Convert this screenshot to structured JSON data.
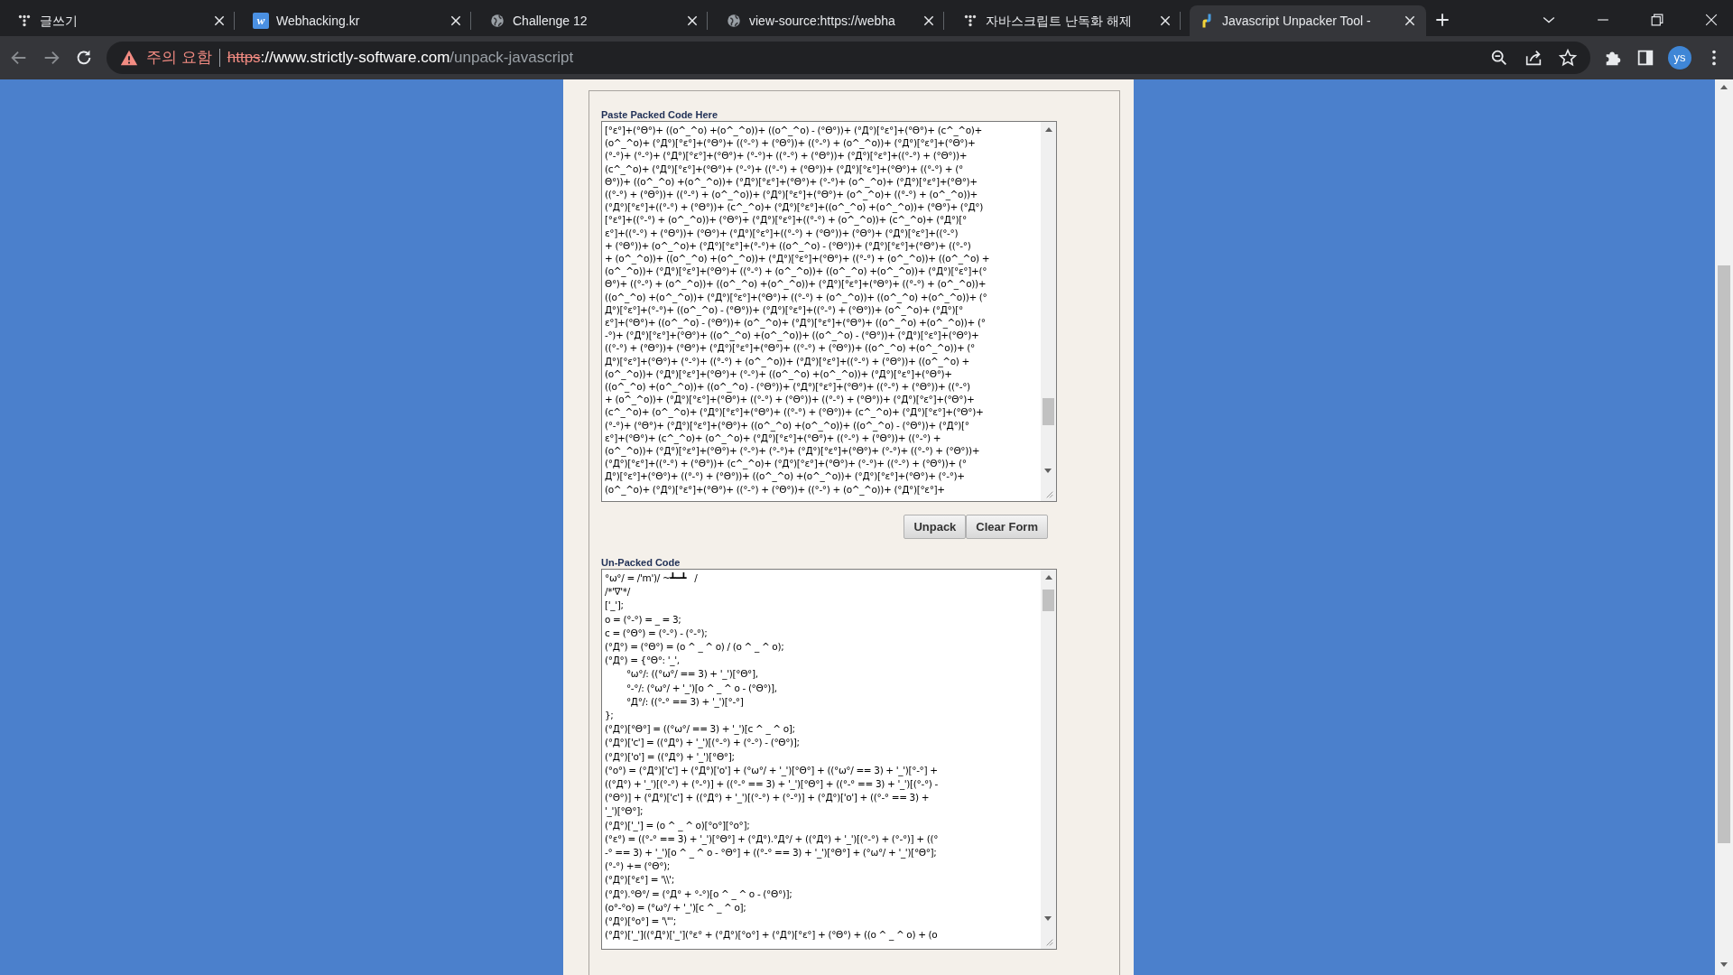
{
  "browser": {
    "tabs": [
      {
        "kind": "dots",
        "title": "글쓰기",
        "selected": false
      },
      {
        "kind": "letter",
        "icon_text": "w",
        "title": "Webhacking.kr",
        "selected": false
      },
      {
        "kind": "globe",
        "title": "Challenge 12",
        "selected": false
      },
      {
        "kind": "globe",
        "title": "view-source:https://webha",
        "selected": false
      },
      {
        "kind": "dots",
        "title": "자바스크립트 난독화 해제",
        "selected": false
      },
      {
        "kind": "js",
        "title": "Javascript Unpacker Tool -",
        "selected": true
      }
    ],
    "address": {
      "warning": "주의 요함",
      "scheme": "https",
      "host": "://www.strictly-software.com",
      "path": "/unpack-javascript"
    },
    "profile": "ys"
  },
  "page": {
    "packed": {
      "label": "Paste Packed Code Here",
      "lines": [
        "[°ε°]+(°Θ°)+ ((o^_^o) +(o^_^o))+ ((o^_^o) - (°Θ°))+ (°Д°)[°ε°]+(°Θ°)+ (c^_^o)+",
        "(o^_^o)+ (°Д°)[°ε°]+(°Θ°)+ ((°-°) + (°Θ°))+ ((°-°) + (o^_^o))+ (°Д°)[°ε°]+(°Θ°)+",
        "(°-°)+ (°-°)+ (°Д°)[°ε°]+(°Θ°)+ (°-°)+ ((°-°) + (°Θ°))+ (°Д°)[°ε°]+((°-°) + (°Θ°))+",
        "(c^_^o)+ (°Д°)[°ε°]+(°Θ°)+ (°-°)+ ((°-°) + (°Θ°))+ (°Д°)[°ε°]+(°Θ°)+ ((°-°) + (°",
        "Θ°))+ ((o^_^o) +(o^_^o))+ (°Д°)[°ε°]+(°Θ°)+ (°-°)+ (o^_^o)+ (°Д°)[°ε°]+(°Θ°)+",
        "((°-°) + (°Θ°))+ ((°-°) + (o^_^o))+ (°Д°)[°ε°]+(°Θ°)+ (o^_^o)+ ((°-°) + (o^_^o))+",
        "(°Д°)[°ε°]+((°-°) + (°Θ°))+ (c^_^o)+ (°Д°)[°ε°]+((o^_^o) +(o^_^o))+ (°Θ°)+ (°Д°)",
        "[°ε°]+((°-°) + (o^_^o))+ (°Θ°)+ (°Д°)[°ε°]+((°-°) + (o^_^o))+ (c^_^o)+ (°Д°)[°",
        "ε°]+((°-°) + (°Θ°))+ (°Θ°)+ (°Д°)[°ε°]+((°-°) + (°Θ°))+ (°Θ°)+ (°Д°)[°ε°]+((°-°)",
        "+ (°Θ°))+ (o^_^o)+ (°Д°)[°ε°]+(°-°)+ ((o^_^o) - (°Θ°))+ (°Д°)[°ε°]+(°Θ°)+ ((°-°)",
        "+ (o^_^o))+ ((o^_^o) +(o^_^o))+ (°Д°)[°ε°]+(°Θ°)+ ((°-°) + (o^_^o))+ ((o^_^o) +",
        "(o^_^o))+ (°Д°)[°ε°]+(°Θ°)+ ((°-°) + (o^_^o))+ ((o^_^o) +(o^_^o))+ (°Д°)[°ε°]+(°",
        "Θ°)+ ((°-°) + (o^_^o))+ ((o^_^o) +(o^_^o))+ (°Д°)[°ε°]+(°Θ°)+ ((°-°) + (o^_^o))+",
        "((o^_^o) +(o^_^o))+ (°Д°)[°ε°]+(°Θ°)+ ((°-°) + (o^_^o))+ ((o^_^o) +(o^_^o))+ (°",
        "Д°)[°ε°]+(°-°)+ ((o^_^o) - (°Θ°))+ (°Д°)[°ε°]+((°-°) + (°Θ°))+ (o^_^o)+ (°Д°)[°",
        "ε°]+(°Θ°)+ ((o^_^o) - (°Θ°))+ (o^_^o)+ (°Д°)[°ε°]+(°Θ°)+ ((o^_^o) +(o^_^o))+ (°",
        "-°)+ (°Д°)[°ε°]+(°Θ°)+ ((o^_^o) +(o^_^o))+ ((o^_^o) - (°Θ°))+ (°Д°)[°ε°]+(°Θ°)+",
        "((°-°) + (°Θ°))+ (°Θ°)+ (°Д°)[°ε°]+(°Θ°)+ ((°-°) + (°Θ°))+ ((o^_^o) +(o^_^o))+ (°",
        "Д°)[°ε°]+(°Θ°)+ (°-°)+ ((°-°) + (o^_^o))+ (°Д°)[°ε°]+((°-°) + (°Θ°))+ ((o^_^o) +",
        "(o^_^o))+ (°Д°)[°ε°]+(°Θ°)+ (°-°)+ ((o^_^o) +(o^_^o))+ (°Д°)[°ε°]+(°Θ°)+",
        "((o^_^o) +(o^_^o))+ ((o^_^o) - (°Θ°))+ (°Д°)[°ε°]+(°Θ°)+ ((°-°) + (°Θ°))+ ((°-°)",
        "+ (o^_^o))+ (°Д°)[°ε°]+(°Θ°)+ ((°-°) + (°Θ°))+ ((°-°) + (°Θ°))+ (°Д°)[°ε°]+(°Θ°)+",
        "(c^_^o)+ (o^_^o)+ (°Д°)[°ε°]+(°Θ°)+ ((°-°) + (°Θ°))+ (c^_^o)+ (°Д°)[°ε°]+(°Θ°)+",
        "(°-°)+ (°Θ°)+ (°Д°)[°ε°]+(°Θ°)+ ((o^_^o) +(o^_^o))+ ((o^_^o) - (°Θ°))+ (°Д°)[°",
        "ε°]+(°Θ°)+ (c^_^o)+ (o^_^o)+ (°Д°)[°ε°]+(°Θ°)+ ((°-°) + (°Θ°))+ ((°-°) +",
        "(o^_^o))+ (°Д°)[°ε°]+(°Θ°)+ (°-°)+ (°-°)+ (°Д°)[°ε°]+(°Θ°)+ (°-°)+ ((°-°) + (°Θ°))+",
        "(°Д°)[°ε°]+((°-°) + (°Θ°))+ (c^_^o)+ (°Д°)[°ε°]+(°Θ°)+ (°-°)+ ((°-°) + (°Θ°))+ (°",
        "Д°)[°ε°]+(°Θ°)+ ((°-°) + (°Θ°))+ ((o^_^o) +(o^_^o))+ (°Д°)[°ε°]+(°Θ°)+ (°-°)+",
        "(o^_^o)+ (°Д°)[°ε°]+(°Θ°)+ ((°-°) + (°Θ°))+ ((°-°) + (o^_^o))+ (°Д°)[°ε°]+"
      ]
    },
    "buttons": [
      "Unpack",
      "Clear Form"
    ],
    "unpacked": {
      "label": "Un-Packed Code",
      "lines": [
        "°ω°/ = /'m')/ ~┻━┻   /",
        "/*'∇'*/",
        "['_'];",
        "o = (°-°) = _ = 3;",
        "c = (°Θ°) = (°-°) - (°-°);",
        "(°Д°) = (°Θ°) = (o ^ _ ^ o) / (o ^ _ ^ o);",
        "(°Д°) = {°Θ°: '_',",
        "        °ω°/: ((°ω°/ == 3) + '_')[°Θ°],",
        "        °-°/: (°ω°/ + '_')[o ^ _ ^ o - (°Θ°)],",
        "        °Д°/: ((°-° == 3) + '_')[°-°]",
        "};",
        "(°Д°)[°Θ°] = ((°ω°/ == 3) + '_')[c ^ _ ^ o];",
        "(°Д°)['c'] = ((°Д°) + '_')[(°-°) + (°-°) - (°Θ°)];",
        "(°Д°)['o'] = ((°Д°) + '_')[°Θ°];",
        "(°o°) = (°Д°)['c'] + (°Д°)['o'] + (°ω°/ + '_')[°Θ°] + ((°ω°/ == 3) + '_')[°-°] +",
        "((°Д°) + '_')[(°-°) + (°-°)] + ((°-° == 3) + '_')[°Θ°] + ((°-° == 3) + '_')[(°-°) -",
        "(°Θ°)] + (°Д°)['c'] + ((°Д°) + '_')[(°-°) + (°-°)] + (°Д°)['o'] + ((°-° == 3) +",
        "'_')[°Θ°];",
        "(°Д°)['_'] = (o ^ _ ^ o)[°o°][°o°];",
        "(°ε°) = ((°-° == 3) + '_')[°Θ°] + (°Д°).°Д°/ + ((°Д°) + '_')[(°-°) + (°-°)] + ((°",
        "-° == 3) + '_')[o ^ _ ^ o - °Θ°] + ((°-° == 3) + '_')[°Θ°] + (°ω°/ + '_')[°Θ°];",
        "(°-°) += (°Θ°);",
        "(°Д°)[°ε°] = '\\\\';",
        "(°Д°).°Θ°/ = (°Д° + °-°)[o ^ _ ^ o - (°Θ°)];",
        "(o°-°o) = (°ω°/ + '_')[c ^ _ ^ o];",
        "(°Д°)[°o°] = '\\\"';",
        "(°Д°)['_']((°Д°)['_'](°ε° + (°Д°)[°o°] + (°Д°)[°ε°] + (°Θ°) + ((o ^ _ ^ o) + (o"
      ]
    }
  }
}
